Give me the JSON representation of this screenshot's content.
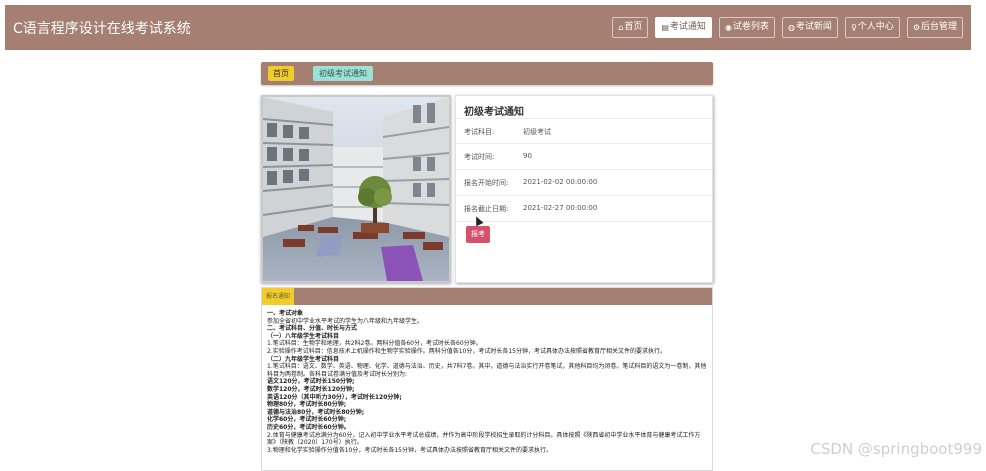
{
  "header": {
    "site_title": "C语言程序设计在线考试系统",
    "nav": [
      {
        "icon": "home-icon",
        "glyph": "⌂",
        "label": "首页",
        "active": false
      },
      {
        "icon": "notice-icon",
        "glyph": "▤",
        "label": "考试通知",
        "active": true
      },
      {
        "icon": "paper-list-icon",
        "glyph": "◉",
        "label": "试卷列表",
        "active": false
      },
      {
        "icon": "news-icon",
        "glyph": "◍",
        "label": "考试新闻",
        "active": false
      },
      {
        "icon": "user-icon",
        "glyph": "♀",
        "label": "个人中心",
        "active": false
      },
      {
        "icon": "admin-icon",
        "glyph": "⚙",
        "label": "后台管理",
        "active": false
      }
    ]
  },
  "breadcrumb": {
    "home": "首页",
    "current": "初级考试通知"
  },
  "detail": {
    "title": "初级考试通知",
    "rows": [
      {
        "label": "考试科目:",
        "value": "初级考试"
      },
      {
        "label": "考试时间:",
        "value": "90"
      },
      {
        "label": "报名开始时间:",
        "value": "2021-02-02 00:00:00"
      },
      {
        "label": "报名截止日期:",
        "value": "2021-02-27 00:00:00"
      }
    ],
    "signup_label": "报考"
  },
  "content": {
    "tab_label": "报名通知",
    "lines": [
      {
        "text": "一、考试对象",
        "bold": true
      },
      {
        "text": "参加全省初中学业水平考试的学生为八年级和九年级学生。",
        "bold": false
      },
      {
        "text": "二、考试科目、分值、时长与方式",
        "bold": true
      },
      {
        "text": "（一）八年级学生考试科目",
        "bold": true
      },
      {
        "text": "1.笔试科目：生物学和地理，共2科2卷。两科分值各60分，考试时长各60分钟。",
        "bold": false
      },
      {
        "text": "2.实验操作考试科目：信息技术上机操作和生物学实验操作。两科分值各10分，考试时长各15分钟，考试具体办法按照省教育厅相关文件的要求执行。",
        "bold": false
      },
      {
        "text": "（二）九年级学生考试科目",
        "bold": true
      },
      {
        "text": "1.笔试科目：语文、数学、英语、物理、化学、道德与法治、历史，共7科7卷。其中，道德与法治实行开卷笔试，其他科目均为闭卷。笔试科目的语文为一卷制，其他科目为两卷制。各科目试卷满分值及考试时长分别为:",
        "bold": false
      },
      {
        "text": "语文120分，考试时长150分钟;",
        "bold": true
      },
      {
        "text": "数学120分，考试时长120分钟;",
        "bold": true
      },
      {
        "text": "英语120分（其中听力30分），考试时长120分钟;",
        "bold": true
      },
      {
        "text": "物理80分，考试时长80分钟;",
        "bold": true
      },
      {
        "text": "道德与法治80分，考试时长80分钟;",
        "bold": true
      },
      {
        "text": "化学60分，考试时长60分钟;",
        "bold": true
      },
      {
        "text": "历史60分，考试时长60分钟。",
        "bold": true
      },
      {
        "text": "2.体育与健康考试总满分为60分，记入初中学业水平考试总成绩，并作为高中阶段学校招生录取的计分科目。具体按照《陕西省初中学业水平体育与健康考试工作方案》（陕教〔2020〕170号）执行。",
        "bold": false
      },
      {
        "text": "3.物理和化学实验操作分值各10分，考试时长各15分钟，考试具体办法按照省教育厅相关文件的要求执行。",
        "bold": false
      }
    ]
  },
  "watermark": "CSDN @springboot999",
  "colors": {
    "brand": "#a47f72",
    "accent_yellow": "#f2cc2a",
    "teal": "#9de0d6",
    "signup": "#d9506a"
  }
}
